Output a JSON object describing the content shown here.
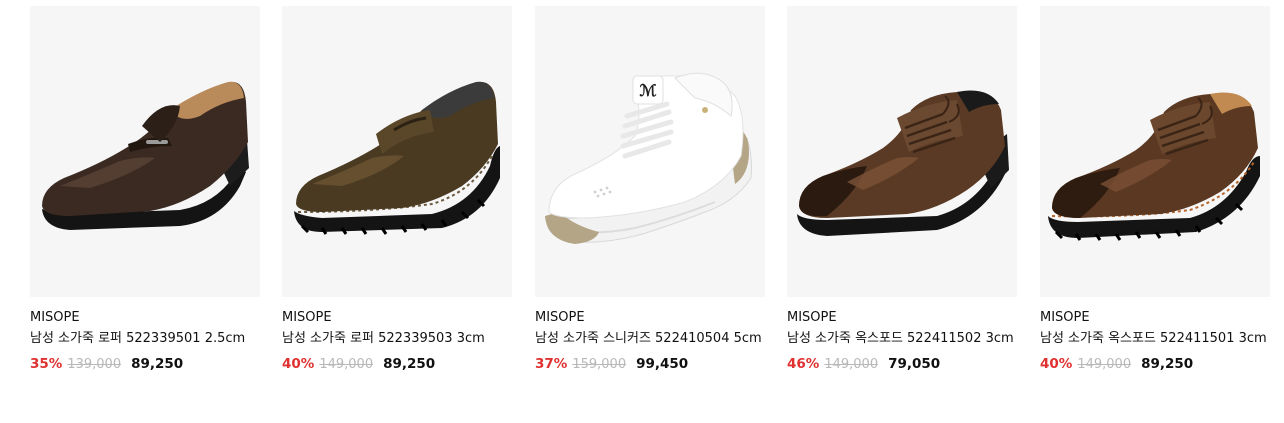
{
  "products": [
    {
      "brand": "MISOPE",
      "name": "남성 소가죽 로퍼 522339501 2.5cm",
      "discount": "35%",
      "original_price": "139,000",
      "sale_price": "89,250",
      "image_icon": "loafer-dark-brown-shoe"
    },
    {
      "brand": "MISOPE",
      "name": "남성 소가죽 로퍼 522339503 3cm",
      "discount": "40%",
      "original_price": "149,000",
      "sale_price": "89,250",
      "image_icon": "penny-loafer-olive-shoe"
    },
    {
      "brand": "MISOPE",
      "name": "남성 소가죽 스니커즈 522410504 5cm",
      "discount": "37%",
      "original_price": "159,000",
      "sale_price": "99,450",
      "image_icon": "white-sneaker-shoe"
    },
    {
      "brand": "MISOPE",
      "name": "남성 소가죽 옥스포드 522411502 3cm",
      "discount": "46%",
      "original_price": "149,000",
      "sale_price": "79,050",
      "image_icon": "oxford-brown-shoe"
    },
    {
      "brand": "MISOPE",
      "name": "남성 소가죽 옥스포드 522411501 3cm",
      "discount": "40%",
      "original_price": "149,000",
      "sale_price": "89,250",
      "image_icon": "oxford-brown-lugsole-shoe"
    }
  ],
  "colors": {
    "discount": "#e03131",
    "original_price": "#b8b8b8",
    "thumb_bg": "#f6f6f6"
  }
}
